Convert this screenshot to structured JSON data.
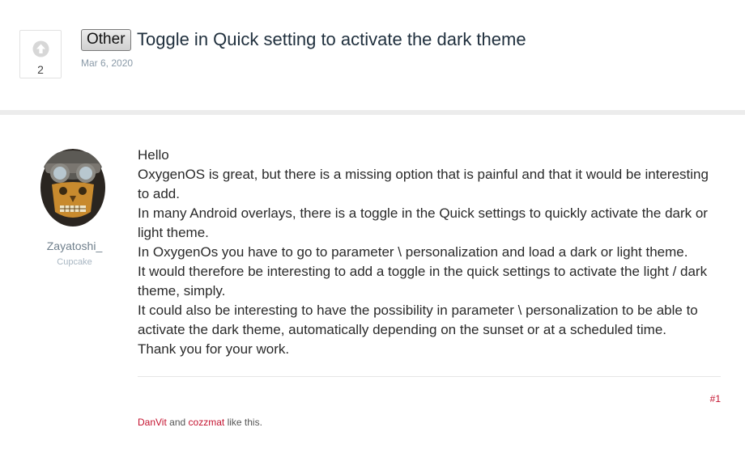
{
  "topic": {
    "vote_count": "2",
    "prefix": "Other",
    "title": "Toggle in Quick setting to activate the dark theme",
    "date": "Mar 6, 2020"
  },
  "author": {
    "name": "Zayatoshi_",
    "rank": "Cupcake"
  },
  "post": {
    "lines": [
      "Hello",
      "OxygenOS is great, but there is a missing option that is painful and that it would be interesting to add.",
      "In many Android overlays, there is a toggle in the Quick settings to quickly activate the dark or light theme.",
      "In OxygenOs you have to go to parameter \\ personalization and load a dark or light theme.",
      "It would therefore be interesting to add a toggle in the quick settings to activate the light / dark theme, simply.",
      "It could also be interesting to have the possibility in parameter \\ personalization to be able to activate the dark theme, automatically depending on the sunset or at a scheduled time.",
      "Thank you for your work."
    ],
    "number": "#1"
  },
  "reactions": {
    "user1": "DanVit",
    "joiner": "and",
    "user2": "cozzmat",
    "suffix": "like this."
  }
}
